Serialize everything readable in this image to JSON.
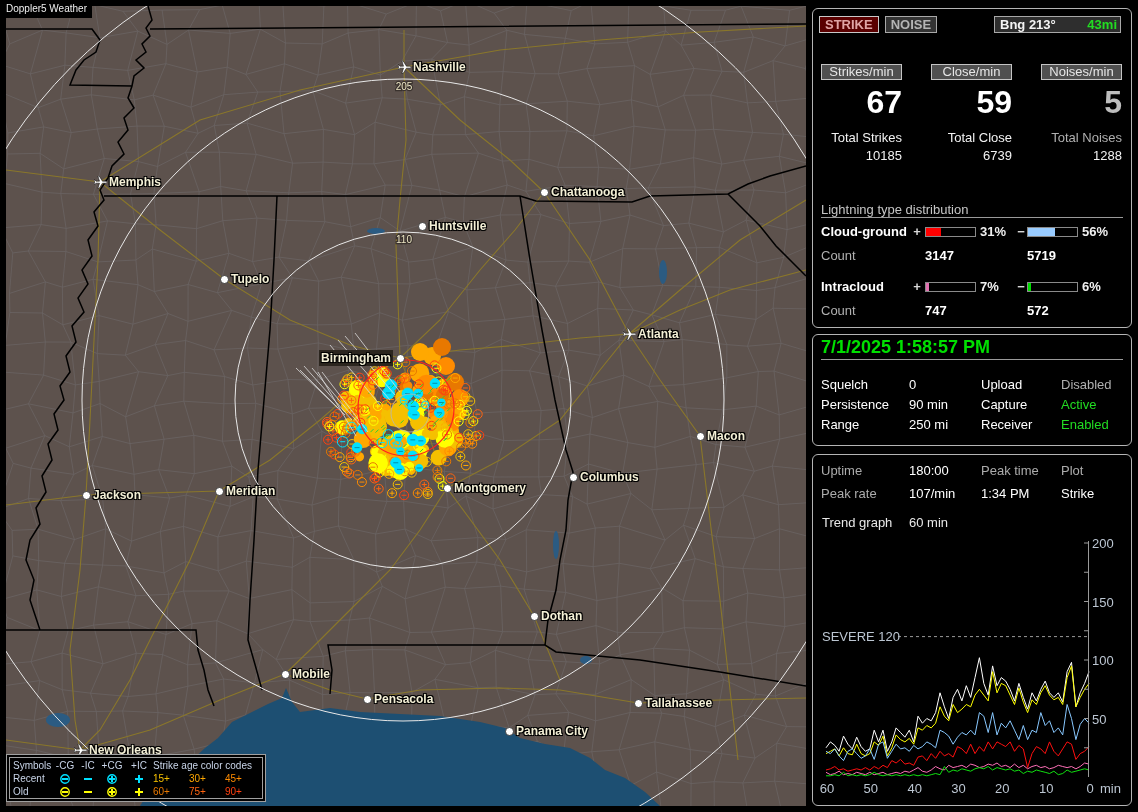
{
  "app": {
    "title": "Doppler5 Weather"
  },
  "map": {
    "range_rings": [
      {
        "label": "205"
      },
      {
        "label": "110"
      }
    ],
    "cities": [
      {
        "name": "Nashville",
        "kind": "airport"
      },
      {
        "name": "Memphis",
        "kind": "airport"
      },
      {
        "name": "Chattanooga",
        "kind": "city"
      },
      {
        "name": "Huntsville",
        "kind": "city"
      },
      {
        "name": "Tupelo",
        "kind": "city"
      },
      {
        "name": "Atlanta",
        "kind": "airport"
      },
      {
        "name": "Birmingham",
        "kind": "city"
      },
      {
        "name": "Macon",
        "kind": "city"
      },
      {
        "name": "Jackson",
        "kind": "city"
      },
      {
        "name": "Meridian",
        "kind": "city"
      },
      {
        "name": "Montgomery",
        "kind": "city"
      },
      {
        "name": "Columbus",
        "kind": "city"
      },
      {
        "name": "Dothan",
        "kind": "city"
      },
      {
        "name": "Mobile",
        "kind": "city"
      },
      {
        "name": "Pensacola",
        "kind": "city"
      },
      {
        "name": "Tallahassee",
        "kind": "city"
      },
      {
        "name": "Panama City",
        "kind": "city"
      },
      {
        "name": "New Orleans",
        "kind": "airport"
      }
    ]
  },
  "legend": {
    "title": "Symbols",
    "symbols": [
      {
        "label": "-CG",
        "kind": "circle-minus"
      },
      {
        "label": "-IC",
        "kind": "minus"
      },
      {
        "label": "+CG",
        "kind": "circle-plus"
      },
      {
        "label": "+IC",
        "kind": "plus"
      }
    ],
    "age_title": "Strike age color codes",
    "rows": [
      {
        "label": "Recent",
        "color": "#00e0ff",
        "ages": [
          {
            "label": "15+",
            "color": "#f5c000"
          },
          {
            "label": "30+",
            "color": "#ffa800"
          },
          {
            "label": "45+",
            "color": "#ff8c00"
          }
        ]
      },
      {
        "label": "Old",
        "color": "#ffff00",
        "ages": [
          {
            "label": "60+",
            "color": "#e87800"
          },
          {
            "label": "75+",
            "color": "#ff6410"
          },
          {
            "label": "90+",
            "color": "#ff4010"
          }
        ]
      }
    ]
  },
  "mode_tabs": [
    {
      "label": "STRIKE",
      "selected": true
    },
    {
      "label": "NOISE",
      "selected": false
    }
  ],
  "bearing": {
    "label": "Bng 213°",
    "distance": "43mi"
  },
  "rates": [
    {
      "header": "Strikes/min",
      "value": "67",
      "total_label": "Total Strikes",
      "total": "10185",
      "dimmed": false
    },
    {
      "header": "Close/min",
      "value": "59",
      "total_label": "Total Close",
      "total": "6739",
      "dimmed": false
    },
    {
      "header": "Noises/min",
      "value": "5",
      "total_label": "Total Noises",
      "total": "1288",
      "dimmed": true
    }
  ],
  "distribution": {
    "title": "Lightning type distribution",
    "rows": [
      {
        "label": "Cloud-ground",
        "count_label": "Count",
        "positive": {
          "sign": "+",
          "level": 0.31,
          "percent": "31%",
          "color": "#ff0000",
          "count": "3147"
        },
        "negative": {
          "sign": "−",
          "level": 0.56,
          "percent": "56%",
          "color": "#99ccff",
          "count": "5719"
        }
      },
      {
        "label": "Intracloud",
        "count_label": "Count",
        "positive": {
          "sign": "+",
          "level": 0.07,
          "percent": "7%",
          "color": "#e070b0",
          "count": "747"
        },
        "negative": {
          "sign": "−",
          "level": 0.06,
          "percent": "6%",
          "color": "#00dd00",
          "count": "572"
        }
      }
    ]
  },
  "status": {
    "datetime": "7/1/2025 1:58:57 PM",
    "settings": [
      {
        "label": "Squelch",
        "value": "0"
      },
      {
        "label": "Persistence",
        "value": "90 min"
      },
      {
        "label": "Range",
        "value": "250 mi"
      }
    ],
    "services": [
      {
        "label": "Upload",
        "value": "Disabled",
        "on": false
      },
      {
        "label": "Capture",
        "value": "Active",
        "on": true
      },
      {
        "label": "Receiver",
        "value": "Enabled",
        "on": true
      }
    ]
  },
  "trend": {
    "stats": [
      {
        "label": "Uptime",
        "value": "180:00"
      },
      {
        "label": "Peak rate",
        "value": "107/min"
      },
      {
        "label": "Peak time",
        "value": "1:34 PM"
      },
      {
        "label": "Plot",
        "value": "Strike"
      }
    ],
    "graph_label": "Trend graph",
    "graph_span": "60 min",
    "chart_data": {
      "type": "line",
      "xlabel": "min",
      "x": [
        60,
        59,
        58,
        57,
        56,
        55,
        54,
        53,
        52,
        51,
        50,
        49,
        48,
        47,
        46,
        45,
        44,
        43,
        42,
        41,
        40,
        39,
        38,
        37,
        36,
        35,
        34,
        33,
        32,
        31,
        30,
        29,
        28,
        27,
        26,
        25,
        24,
        23,
        22,
        21,
        20,
        19,
        18,
        17,
        16,
        15,
        14,
        13,
        12,
        11,
        10,
        9,
        8,
        7,
        6,
        5,
        4,
        3,
        2,
        1,
        0
      ],
      "xlim": [
        60,
        0
      ],
      "ylim": [
        0,
        200
      ],
      "xticks": [
        60,
        50,
        40,
        30,
        20,
        10,
        0
      ],
      "yticks": [
        50,
        100,
        150,
        200
      ],
      "series": [
        {
          "color": "#ffffff",
          "values": [
            25,
            30,
            27,
            22,
            35,
            28,
            24,
            34,
            26,
            22,
            24,
            40,
            30,
            40,
            22,
            30,
            42,
            38,
            34,
            40,
            30,
            52,
            46,
            50,
            48,
            55,
            72,
            60,
            50,
            68,
            75,
            65,
            78,
            68,
            85,
            102,
            80,
            70,
            95,
            78,
            85,
            82,
            75,
            65,
            80,
            68,
            58,
            72,
            65,
            75,
            82,
            72,
            68,
            72,
            64,
            90,
            98,
            60,
            72,
            80,
            90
          ]
        },
        {
          "color": "#ffff00",
          "values": [
            20,
            22,
            24,
            18,
            25,
            20,
            19,
            28,
            20,
            18,
            20,
            30,
            27,
            35,
            18,
            25,
            36,
            32,
            30,
            33,
            28,
            42,
            40,
            44,
            42,
            46,
            60,
            52,
            48,
            62,
            55,
            58,
            62,
            60,
            70,
            75,
            70,
            65,
            90,
            72,
            80,
            78,
            70,
            62,
            76,
            64,
            55,
            66,
            62,
            72,
            78,
            70,
            66,
            68,
            62,
            85,
            95,
            60,
            68,
            75,
            80
          ]
        },
        {
          "color": "#88c8ff",
          "values": [
            22,
            20,
            24,
            18,
            14,
            22,
            24,
            20,
            16,
            18,
            24,
            15,
            28,
            30,
            16,
            22,
            28,
            24,
            25,
            22,
            27,
            24,
            26,
            30,
            28,
            25,
            40,
            38,
            35,
            28,
            34,
            38,
            36,
            40,
            36,
            55,
            52,
            38,
            55,
            36,
            46,
            42,
            48,
            40,
            32,
            44,
            32,
            40,
            38,
            55,
            44,
            48,
            38,
            42,
            36,
            62,
            50,
            32,
            45,
            50,
            46
          ]
        },
        {
          "color": "#ff1010",
          "values": [
            6,
            7,
            9,
            6,
            7,
            5,
            6,
            7,
            6,
            8,
            6,
            9,
            7,
            10,
            8,
            14,
            12,
            15,
            11,
            12,
            10,
            17,
            18,
            14,
            20,
            16,
            22,
            18,
            20,
            17,
            26,
            24,
            20,
            28,
            20,
            26,
            22,
            30,
            24,
            30,
            28,
            26,
            30,
            22,
            27,
            24,
            8,
            20,
            26,
            24,
            20,
            30,
            22,
            18,
            24,
            30,
            28,
            15,
            20,
            22,
            26
          ]
        },
        {
          "color": "#ff70b8",
          "values": [
            4,
            2,
            3,
            5,
            2,
            3,
            2,
            4,
            3,
            2,
            4,
            2,
            3,
            4,
            2,
            3,
            4,
            3,
            5,
            4,
            6,
            8,
            5,
            4,
            6,
            9,
            7,
            6,
            10,
            8,
            9,
            10,
            8,
            11,
            10,
            8,
            9,
            11,
            10,
            12,
            9,
            10,
            8,
            11,
            8,
            10,
            7,
            9,
            10,
            8,
            9,
            7,
            8,
            10,
            9,
            8,
            9,
            7,
            9,
            12,
            11
          ]
        },
        {
          "color": "#10e010",
          "values": [
            1,
            1,
            2,
            1,
            4,
            1,
            2,
            1,
            2,
            1,
            2,
            4,
            2,
            1,
            2,
            1,
            2,
            1,
            2,
            1,
            2,
            1,
            2,
            1,
            2,
            3,
            2,
            9,
            4,
            6,
            5,
            7,
            6,
            5,
            7,
            8,
            7,
            9,
            6,
            8,
            7,
            6,
            7,
            5,
            6,
            3,
            5,
            4,
            6,
            5,
            4,
            3,
            5,
            2,
            3,
            6,
            4,
            5,
            6,
            7,
            6
          ]
        }
      ],
      "ref_lines": [
        {
          "axis": "y",
          "value": 120,
          "label": "SEVERE 120"
        }
      ]
    }
  }
}
